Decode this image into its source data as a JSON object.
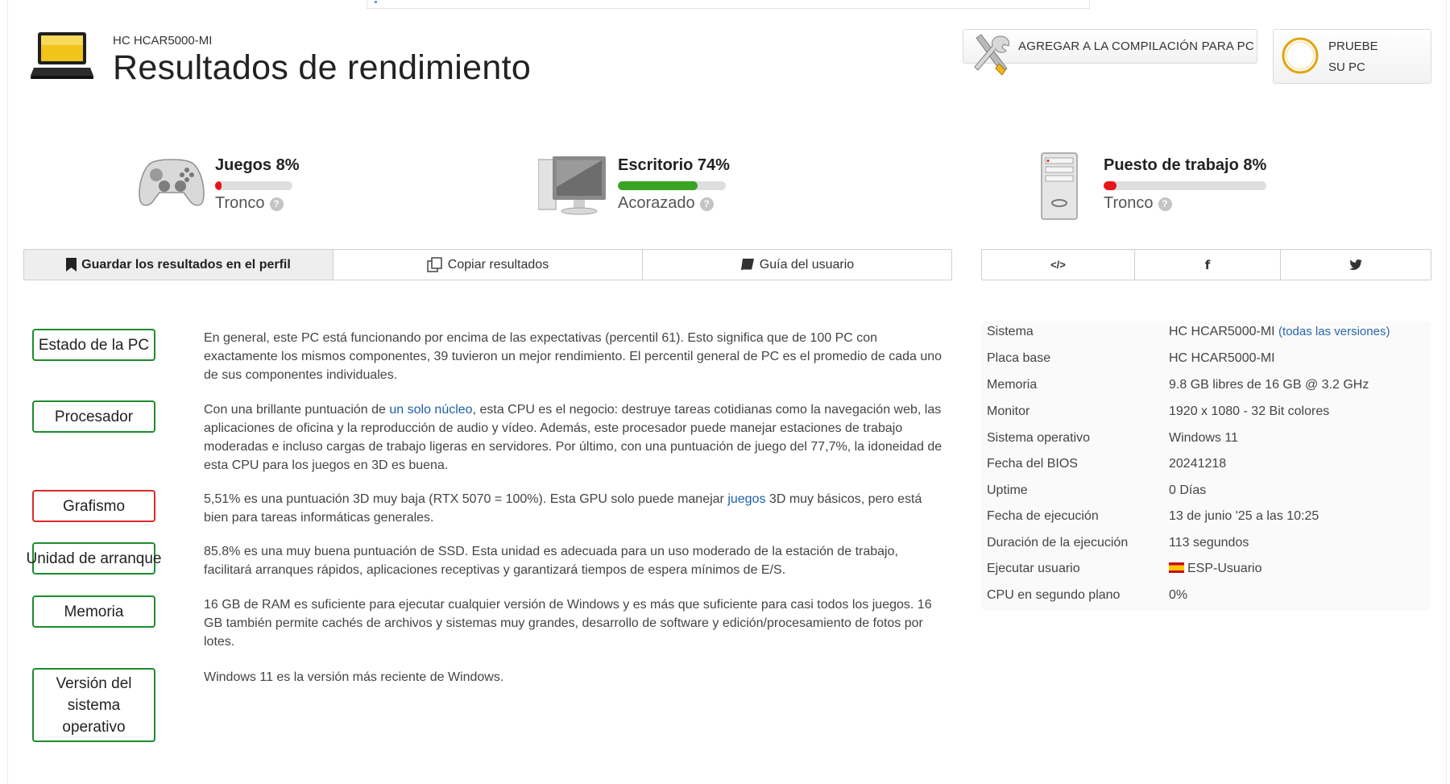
{
  "header": {
    "subtitle": "HC HCAR5000-MI",
    "title": "Resultados de rendimiento",
    "build_button": "AGREGAR A LA COMPILACIÓN PARA PC",
    "test_button_line1": "PRUEBE",
    "test_button_line2": "SU PC"
  },
  "scores": [
    {
      "title": "Juegos 8%",
      "rating": "Tronco",
      "percent": 8,
      "color": "#e8141c",
      "icon": "gamepad-icon"
    },
    {
      "title": "Escritorio 74%",
      "rating": "Acorazado",
      "percent": 74,
      "color": "#3aa321",
      "icon": "desktop-monitor-icon"
    },
    {
      "title": "Puesto de trabajo 8%",
      "rating": "Tronco",
      "percent": 8,
      "color": "#e8141c",
      "icon": "workstation-tower-icon"
    }
  ],
  "help_glyph": "?",
  "actions": {
    "save": "Guardar los resultados en el perfil",
    "copy": "Copiar resultados",
    "guide": "Guía del usuario"
  },
  "share": {
    "embed": "</>",
    "facebook": "f",
    "twitter": "twitter-icon"
  },
  "verdicts": [
    {
      "label": "Estado de la PC",
      "status": "good",
      "text_before": "En general, este PC está funcionando por encima de las expectativas (percentil 61). Esto significa que de 100 PC con exactamente los mismos componentes, 39 tuvieron un mejor rendimiento. El percentil general de PC es el promedio de cada uno de sus componentes individuales."
    },
    {
      "label": "Procesador",
      "status": "good",
      "text_before": "Con una brillante puntuación de ",
      "link": "un solo núcleo",
      "text_after": ", esta CPU es el negocio: destruye tareas cotidianas como la navegación web, las aplicaciones de oficina y la reproducción de audio y vídeo. Además, este procesador puede manejar estaciones de trabajo moderadas e incluso cargas de trabajo ligeras en servidores. Por último, con una puntuación de juego del 77,7%, la idoneidad de esta CPU para los juegos en 3D es buena."
    },
    {
      "label": "Grafismo",
      "status": "bad",
      "text_before": "5,51% es una puntuación 3D muy baja (RTX 5070 = 100%). Esta GPU solo puede manejar ",
      "link": "juegos",
      "text_after": " 3D muy básicos, pero está bien para tareas informáticas generales."
    },
    {
      "label": "Unidad de arranque",
      "status": "good",
      "text_before": "85.8% es una muy buena puntuación de SSD. Esta unidad es adecuada para un uso moderado de la estación de trabajo, facilitará arranques rápidos, aplicaciones receptivas y garantizará tiempos de espera mínimos de E/S."
    },
    {
      "label": "Memoria",
      "status": "good",
      "text_before": "16 GB de RAM es suficiente para ejecutar cualquier versión de Windows y es más que suficiente para casi todos los juegos. 16 GB también permite cachés de archivos y sistemas muy grandes, desarrollo de software y edición/procesamiento de fotos por lotes."
    },
    {
      "label": "Versión del sistema operativo",
      "status": "good",
      "text_before": "Windows 11 es la versión más reciente de Windows."
    }
  ],
  "specs": [
    {
      "key": "Sistema",
      "value": "HC HCAR5000-MI",
      "extra": "(todas las versiones)"
    },
    {
      "key": "Placa base",
      "value": "HC HCAR5000-MI"
    },
    {
      "key": "Memoria",
      "value": "9.8 GB libres de 16 GB @ 3.2 GHz"
    },
    {
      "key": "Monitor",
      "value": "1920 x 1080 - 32 Bit colores"
    },
    {
      "key": "Sistema operativo",
      "value": "Windows 11"
    },
    {
      "key": "Fecha del BIOS",
      "value": "20241218"
    },
    {
      "key": "Uptime",
      "value": "0 Días"
    },
    {
      "key": "Fecha de ejecución",
      "value": "13 de junio '25 a las 10:25"
    },
    {
      "key": "Duración de la ejecución",
      "value": "113 segundos"
    },
    {
      "key": "Ejecutar usuario",
      "value": "ESP-Usuario",
      "flag": "spain-flag-icon"
    },
    {
      "key": "CPU en segundo plano",
      "value": "0%"
    }
  ],
  "colors": {
    "good_border": "#1e8c2e",
    "bad_border": "#d92a2a",
    "link": "#1d5fa8"
  }
}
